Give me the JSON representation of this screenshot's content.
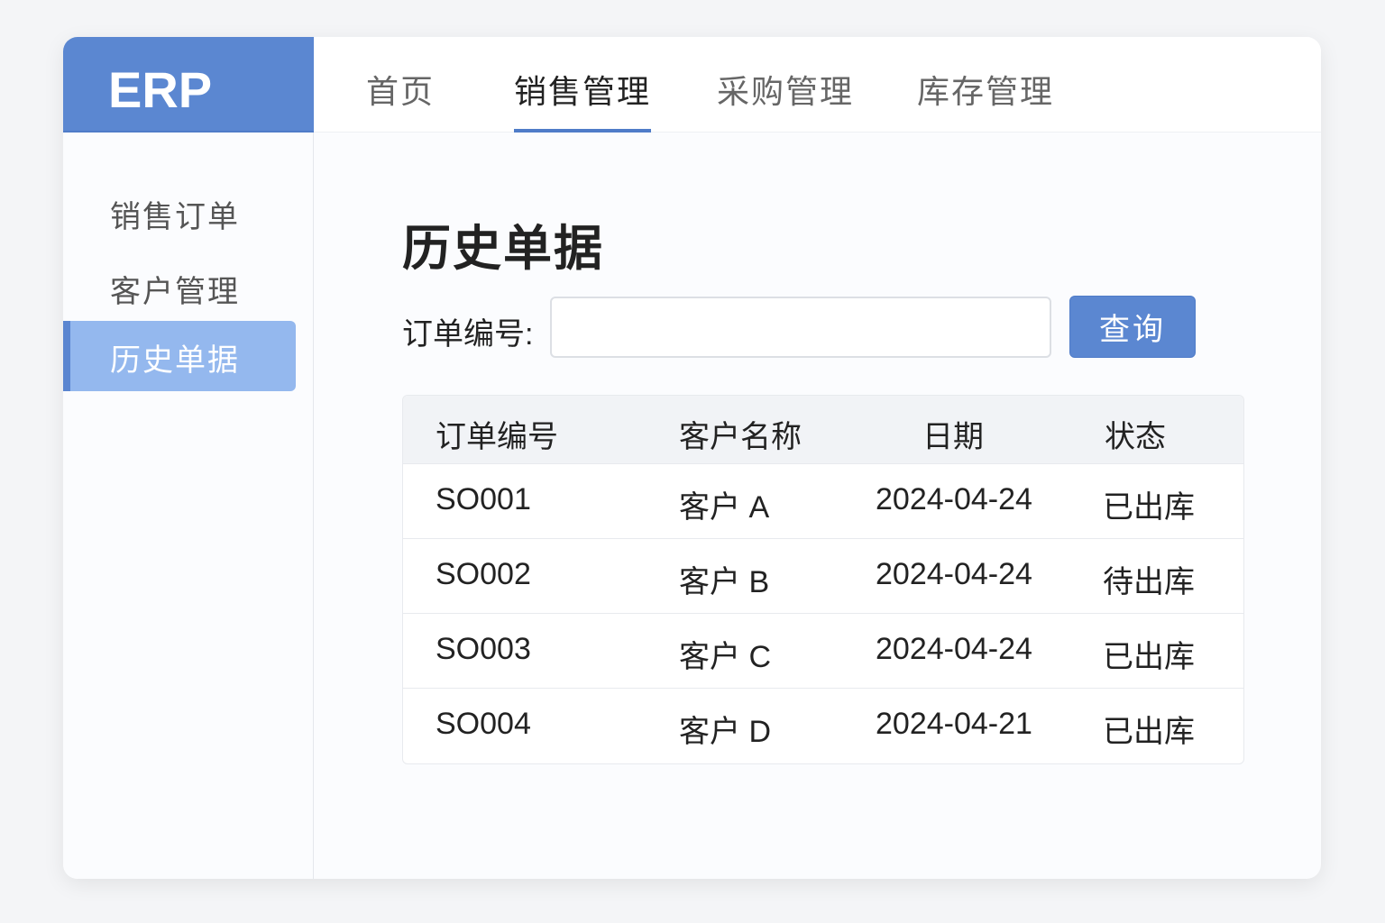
{
  "app": {
    "logo": "ERP"
  },
  "nav": {
    "tabs": [
      {
        "label": "首页"
      },
      {
        "label": "销售管理",
        "active": true
      },
      {
        "label": "采购管理"
      },
      {
        "label": "库存管理"
      }
    ]
  },
  "sidebar": {
    "items": [
      {
        "label": "销售订单"
      },
      {
        "label": "客户管理"
      },
      {
        "label": "历史单据",
        "active": true
      }
    ]
  },
  "main": {
    "title": "历史单据",
    "search": {
      "label": "订单编号:",
      "value": "",
      "placeholder": ""
    },
    "query_button": "查询",
    "table": {
      "headers": [
        "订单编号",
        "客户名称",
        "日期",
        "状态"
      ],
      "rows": [
        [
          "SO001",
          "客户 A",
          "2024-04-24",
          "已出库"
        ],
        [
          "SO002",
          "客户 B",
          "2024-04-24",
          "待出库"
        ],
        [
          "SO003",
          "客户 C",
          "2024-04-24",
          "已出库"
        ],
        [
          "SO004",
          "客户 D",
          "2024-04-21",
          "已出库"
        ]
      ]
    }
  },
  "colors": {
    "accent": "#5b87d1",
    "active_item": "#94b8ee"
  }
}
